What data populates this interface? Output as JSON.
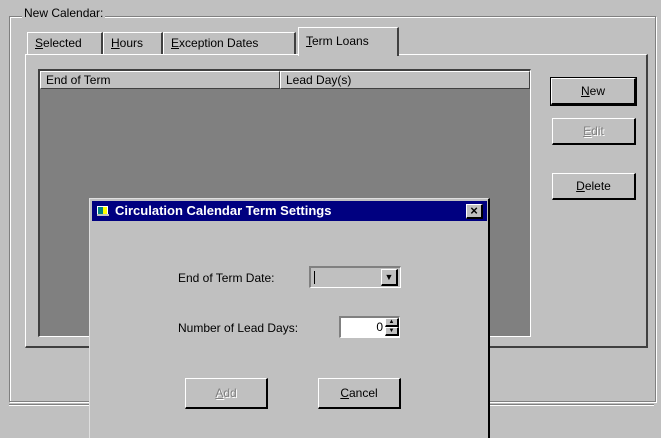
{
  "group": {
    "legend": "New Calendar:"
  },
  "tabs": [
    {
      "pre": "",
      "key": "S",
      "post": "elected"
    },
    {
      "pre": "",
      "key": "H",
      "post": "ours"
    },
    {
      "pre": "",
      "key": "E",
      "post": "xception Dates"
    },
    {
      "pre": "",
      "key": "T",
      "post": "erm Loans"
    }
  ],
  "active_tab": "Term Loans",
  "list": {
    "columns": [
      "End of Term",
      "Lead Day(s)"
    ]
  },
  "side_buttons": {
    "new": {
      "key": "N",
      "post": "ew"
    },
    "edit": {
      "key": "E",
      "post": "dit"
    },
    "delete": {
      "key": "D",
      "post": "elete"
    }
  },
  "dialog": {
    "title": "Circulation Calendar Term Settings",
    "close": "×",
    "end_of_term_label": "End of Term  Date:",
    "lead_days_label": "Number of Lead Days:",
    "lead_days_value": "0",
    "add": {
      "key": "A",
      "post": "dd"
    },
    "cancel": {
      "key": "C",
      "post": "ancel"
    }
  }
}
